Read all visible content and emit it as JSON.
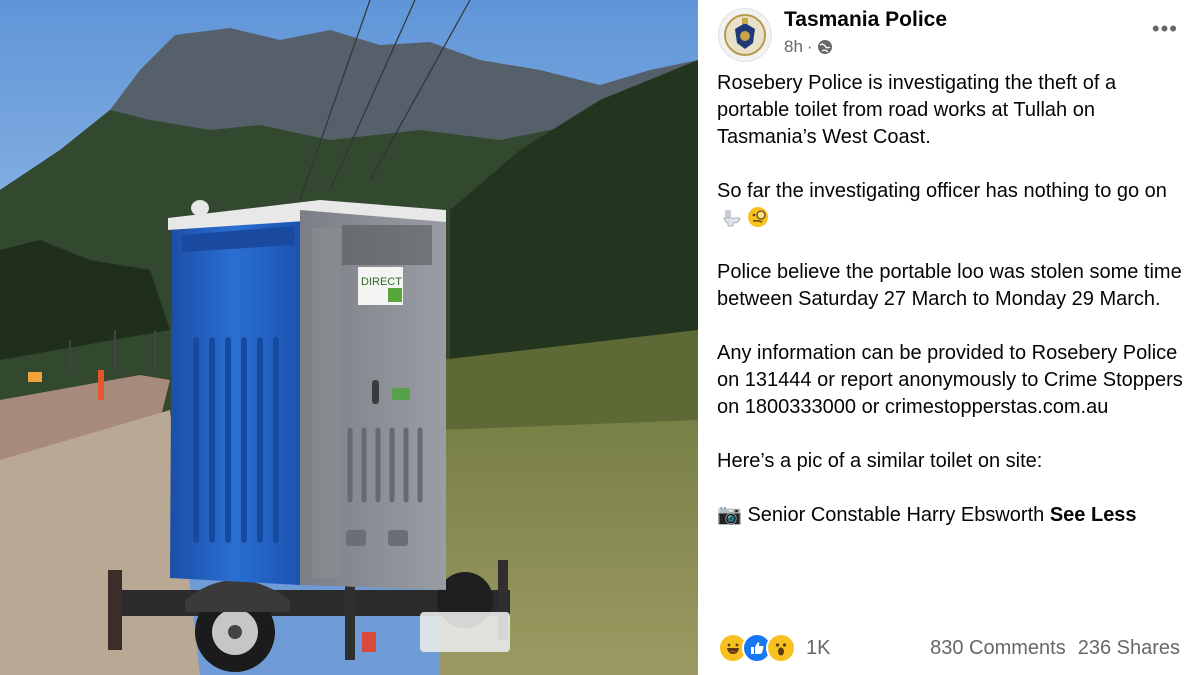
{
  "post": {
    "page_name": "Tasmania Police",
    "time": "8h",
    "more_label": "•••",
    "paragraphs": {
      "p1": "Rosebery Police is investigating the theft of a portable toilet from road works at Tullah on Tasmania’s West Coast.",
      "p2": "So far the investigating officer has nothing to go on",
      "p3": "Police believe the portable loo was stolen some time between Saturday 27 March to Monday 29 March.",
      "p4": "Any information can be provided to Rosebery Police on 131444 or report anonymously to Crime Stoppers on 1800333000 or crimestopperstas.com.au",
      "p5": "Here’s a pic of a similar toilet on site:",
      "p6_prefix": "📷",
      "p6": "Senior Constable Harry Ebsworth",
      "see_less": "See Less"
    },
    "emoji": [
      "toilet-emoji",
      "face-with-monocle-emoji"
    ],
    "footer": {
      "reactions": [
        "haha",
        "like",
        "wow"
      ],
      "reaction_count": "1K",
      "comments": "830 Comments",
      "shares": "236 Shares"
    }
  },
  "photo": {
    "toilet_sign_text": "DIRECT",
    "colors": {
      "sky": "#6fa1dd",
      "toilet_blue": "#1f5fc0",
      "toilet_grey": "#8a8d92"
    }
  }
}
